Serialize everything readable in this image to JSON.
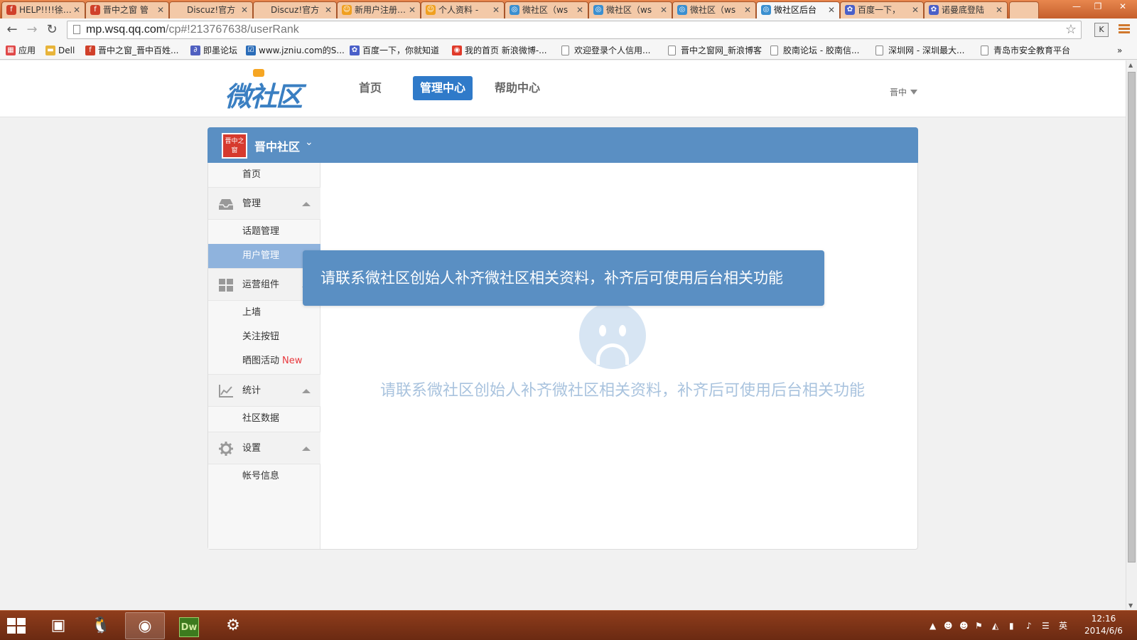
{
  "browser": {
    "tabs": [
      {
        "title": "HELP!!!!徐…",
        "icon_color": "#d0402a"
      },
      {
        "title": "晋中之窗 管",
        "icon_color": "#d0402a"
      },
      {
        "title": "Discuz!官方",
        "icon_color": ""
      },
      {
        "title": "Discuz!官方",
        "icon_color": ""
      },
      {
        "title": "新用户注册…",
        "icon_color": "#f0a020"
      },
      {
        "title": "个人资料 -",
        "icon_color": "#f0a020"
      },
      {
        "title": "微社区（ws",
        "icon_color": "#3a8fd0"
      },
      {
        "title": "微社区（ws",
        "icon_color": "#3a8fd0"
      },
      {
        "title": "微社区（ws",
        "icon_color": "#3a8fd0"
      },
      {
        "title": "微社区后台",
        "icon_color": "#3a8fd0",
        "active": true
      },
      {
        "title": "百度一下，",
        "icon_color": "#4a5fc8"
      },
      {
        "title": "诺曼底登陆",
        "icon_color": "#4a5fc8"
      }
    ],
    "url_host": "mp.wsq.qq.com",
    "url_path": "/cp#!213767638/userRank",
    "extension_label": "K",
    "bookmarks": [
      {
        "label": "应用",
        "icon": "apps-icon"
      },
      {
        "label": "Dell",
        "icon": "folder-icon"
      },
      {
        "label": "晋中之窗_晋中百姓...",
        "icon": "site-icon"
      },
      {
        "label": "即墨论坛",
        "icon": "site-icon"
      },
      {
        "label": "www.jzniu.com的S...",
        "icon": "site-icon"
      },
      {
        "label": "百度一下，你就知道",
        "icon": "baidu-icon"
      },
      {
        "label": "我的首页 新浪微博-...",
        "icon": "weibo-icon"
      },
      {
        "label": "欢迎登录个人信用...",
        "icon": "page-icon"
      },
      {
        "label": "晋中之窗网_新浪博客",
        "icon": "page-icon"
      },
      {
        "label": "胶南论坛 - 胶南信...",
        "icon": "page-icon"
      },
      {
        "label": "深圳网 - 深圳最大...",
        "icon": "page-icon"
      },
      {
        "label": "青岛市安全教育平台",
        "icon": "page-icon"
      }
    ]
  },
  "site": {
    "logo_text": "微社区",
    "nav": {
      "home": "首页",
      "admin": "管理中心",
      "help": "帮助中心"
    },
    "user_name": "晋中"
  },
  "community": {
    "name": "晋中社区",
    "logo_text": "晋中之窗"
  },
  "sidebar": {
    "home": "首页",
    "manage_group": "管理",
    "topic_manage": "话题管理",
    "user_manage": "用户管理",
    "ops_group": "运营组件",
    "wall": "上墙",
    "follow_button": "关注按钮",
    "photo_event": "晒图活动",
    "new_badge": "New",
    "stats_group": "统计",
    "community_data": "社区数据",
    "settings_group": "设置",
    "account_info": "帐号信息"
  },
  "content": {
    "toast_message": "请联系微社区创始人补齐微社区相关资料，补齐后可使用后台相关功能",
    "empty_message": "请联系微社区创始人补齐微社区相关资料，补齐后可使用后台相关功能"
  },
  "taskbar": {
    "dw_label": "Dw",
    "ime": "英",
    "time": "12:16",
    "date": "2014/6/6"
  },
  "colors": {
    "accent_blue": "#5a8fc3",
    "nav_active": "#2f7ac9",
    "sidebar_active": "#8fb3dd",
    "new_badge": "#e8383d",
    "empty_text": "#a9c3de"
  }
}
